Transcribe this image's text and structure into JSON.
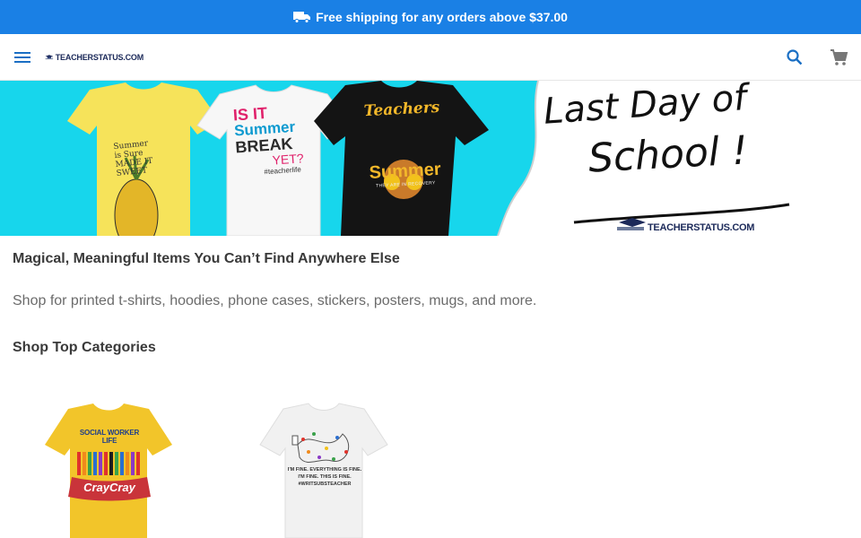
{
  "promo": {
    "text": "Free shipping for any orders above $37.00",
    "icon": "truck-icon"
  },
  "header": {
    "menu_icon": "menu-icon",
    "logo_text": "TEACHERSTATUS.COM",
    "search_icon": "search-icon",
    "cart_icon": "cart-icon"
  },
  "hero": {
    "shirt1_lines": [
      "Summer",
      "is Sure",
      "MADE IT",
      "SWEET"
    ],
    "shirt2_lines": [
      "IS IT",
      "Summer",
      "BREAK",
      "YET?",
      "#teacherlife"
    ],
    "shirt3_lines": [
      "Teachers",
      "Summer",
      "THEY ARE IN RECOVERY"
    ],
    "headline_line1": "Last Day of",
    "headline_line2": "School !",
    "brand": "TEACHERSTATUS.COM"
  },
  "main": {
    "tagline": "Magical, Meaningful Items You Can’t Find Anywhere Else",
    "subtext": "Shop for printed t-shirts, hoodies, phone cases, stickers, posters, mugs, and more.",
    "categories_title": "Shop Top Categories"
  },
  "categories": [
    {
      "shirt_top": "SOCIAL WORKER LIFE",
      "shirt_bottom": "CrayCray"
    },
    {
      "shirt_line1": "I'M FINE. EVERYTHING IS FINE.",
      "shirt_line2": "I'M FINE. THIS IS FINE.",
      "shirt_line3": "#WRITSUBSTEACHER"
    }
  ],
  "colors": {
    "promo_bg": "#1a80e5",
    "hero_cyan": "#17d6ec",
    "yellow_shirt": "#f6e35a",
    "text_dark": "#3a3a3a",
    "text_muted": "#6b6b6b"
  }
}
